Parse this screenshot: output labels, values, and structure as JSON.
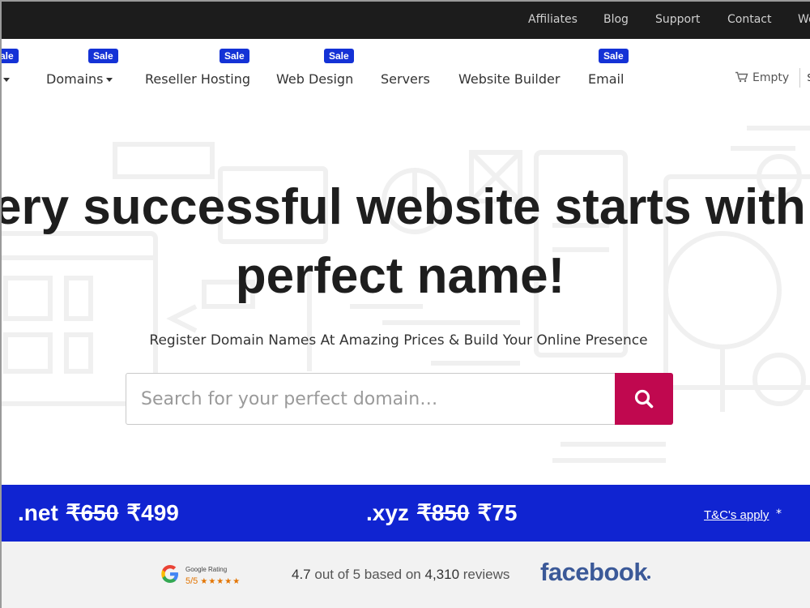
{
  "topbar": {
    "links": [
      "Affiliates",
      "Blog",
      "Support",
      "Contact",
      "We"
    ]
  },
  "nav": {
    "items": [
      {
        "label": "",
        "has_caret": true
      },
      {
        "label": "Domains",
        "has_caret": true
      },
      {
        "label": "Reseller Hosting",
        "has_caret": false
      },
      {
        "label": "Web Design",
        "has_caret": false
      },
      {
        "label": "Servers",
        "has_caret": false
      },
      {
        "label": "Website Builder",
        "has_caret": false
      },
      {
        "label": "Email",
        "has_caret": false
      }
    ],
    "sale_badge": "Sale",
    "sale_badge_partial": "ale",
    "cart_label": "Empty",
    "cart_extra": "$"
  },
  "hero": {
    "headline_line1": "ery successful website starts with",
    "headline_line2": "perfect name!",
    "subhead": "Register Domain Names At Amazing Prices & Build Your Online Presence",
    "search_placeholder": "Search for your perfect domain…"
  },
  "promo": {
    "offers": [
      {
        "tld": ".net",
        "old_price": "₹650",
        "new_price": "₹499"
      },
      {
        "tld": ".xyz",
        "old_price": "₹850",
        "new_price": "₹75"
      }
    ],
    "terms_label": "T&C's apply",
    "terms_mark": "*"
  },
  "ratings": {
    "google_label": "Google Rating",
    "google_score": "5/5",
    "google_stars": "★★★★★",
    "summary_prefix": "4.7",
    "summary_mid": " out of 5 based on ",
    "summary_count": "4,310",
    "summary_suffix": " reviews",
    "facebook_label": "facebook"
  },
  "colors": {
    "topbar": "#1c1c1c",
    "sale_badge": "#1432d6",
    "search_button": "#c0084f",
    "promo_band": "#1024d1",
    "facebook": "#3b5998"
  }
}
